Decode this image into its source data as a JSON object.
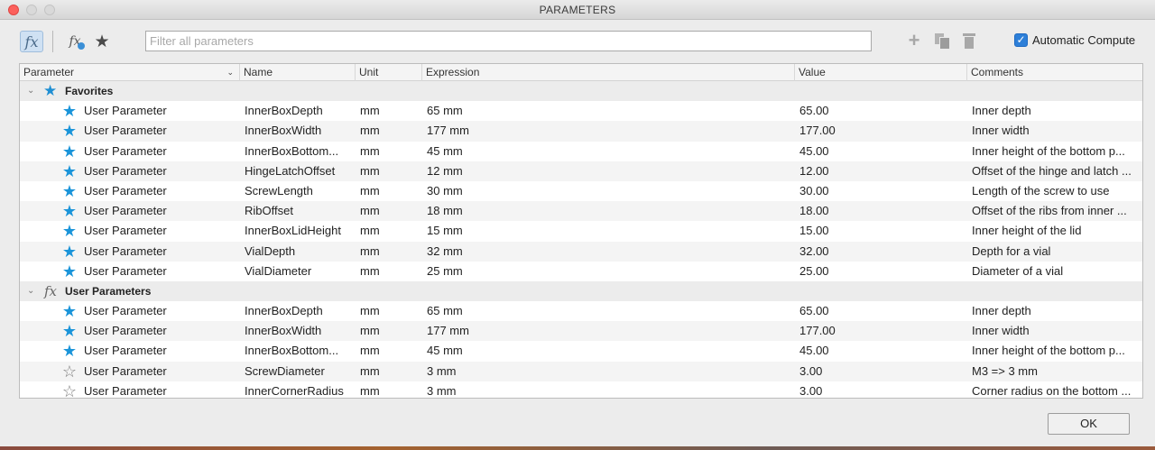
{
  "window": {
    "title": "PARAMETERS"
  },
  "toolbar": {
    "fx_icon": "fx",
    "fx_user_icon": "fx",
    "star_icon": "★",
    "search_placeholder": "Filter all parameters",
    "add_icon": "+",
    "auto_compute_label": "Automatic Compute",
    "auto_compute_checked": true,
    "check_glyph": "✓"
  },
  "table": {
    "headers": {
      "parameter": "Parameter",
      "name": "Name",
      "unit": "Unit",
      "expression": "Expression",
      "value": "Value",
      "comments": "Comments"
    },
    "sort_caret": "⌄",
    "group_favorites": "Favorites",
    "group_user": "User Parameters",
    "group_chevron": "⌄",
    "group_fav_icon": "★",
    "group_user_icon": "fx",
    "favorites": [
      {
        "star": "★",
        "param": "User Parameter",
        "name": "InnerBoxDepth",
        "unit": "mm",
        "expr": "65 mm",
        "value": "65.00",
        "comment": "Inner depth"
      },
      {
        "star": "★",
        "param": "User Parameter",
        "name": "InnerBoxWidth",
        "unit": "mm",
        "expr": "177 mm",
        "value": "177.00",
        "comment": "Inner width"
      },
      {
        "star": "★",
        "param": "User Parameter",
        "name": "InnerBoxBottom...",
        "unit": "mm",
        "expr": "45 mm",
        "value": "45.00",
        "comment": "Inner height of the bottom p..."
      },
      {
        "star": "★",
        "param": "User Parameter",
        "name": "HingeLatchOffset",
        "unit": "mm",
        "expr": "12 mm",
        "value": "12.00",
        "comment": "Offset of the hinge and latch ..."
      },
      {
        "star": "★",
        "param": "User Parameter",
        "name": "ScrewLength",
        "unit": "mm",
        "expr": "30 mm",
        "value": "30.00",
        "comment": "Length of the screw to use"
      },
      {
        "star": "★",
        "param": "User Parameter",
        "name": "RibOffset",
        "unit": "mm",
        "expr": "18 mm",
        "value": "18.00",
        "comment": "Offset of the ribs from inner ..."
      },
      {
        "star": "★",
        "param": "User Parameter",
        "name": "InnerBoxLidHeight",
        "unit": "mm",
        "expr": "15 mm",
        "value": "15.00",
        "comment": "Inner height of the lid"
      },
      {
        "star": "★",
        "param": "User Parameter",
        "name": "VialDepth",
        "unit": "mm",
        "expr": "32 mm",
        "value": "32.00",
        "comment": "Depth for a vial"
      },
      {
        "star": "★",
        "param": "User Parameter",
        "name": "VialDiameter",
        "unit": "mm",
        "expr": "25 mm",
        "value": "25.00",
        "comment": "Diameter of a vial"
      }
    ],
    "user_params": [
      {
        "star": "★",
        "fav": true,
        "param": "User Parameter",
        "name": "InnerBoxDepth",
        "unit": "mm",
        "expr": "65 mm",
        "value": "65.00",
        "comment": "Inner depth"
      },
      {
        "star": "★",
        "fav": true,
        "param": "User Parameter",
        "name": "InnerBoxWidth",
        "unit": "mm",
        "expr": "177 mm",
        "value": "177.00",
        "comment": "Inner width"
      },
      {
        "star": "★",
        "fav": true,
        "param": "User Parameter",
        "name": "InnerBoxBottom...",
        "unit": "mm",
        "expr": "45 mm",
        "value": "45.00",
        "comment": "Inner height of the bottom p..."
      },
      {
        "star": "☆",
        "fav": false,
        "param": "User Parameter",
        "name": "ScrewDiameter",
        "unit": "mm",
        "expr": "3 mm",
        "value": "3.00",
        "comment": "M3 => 3 mm"
      },
      {
        "star": "☆",
        "fav": false,
        "param": "User Parameter",
        "name": "InnerCornerRadius",
        "unit": "mm",
        "expr": "3 mm",
        "value": "3.00",
        "comment": "Corner radius on the bottom ..."
      }
    ]
  },
  "footer": {
    "ok_label": "OK"
  },
  "colors": {
    "accent": "#2d7fd8",
    "favorite_star": "#1a94d9",
    "close_button": "#fc605c"
  },
  "icons": [
    "close-window-icon",
    "fx-icon",
    "fx-user-icon",
    "star-icon",
    "add-icon",
    "copy-icon",
    "trash-icon",
    "chevron-down-icon",
    "favorite-star-icon"
  ]
}
